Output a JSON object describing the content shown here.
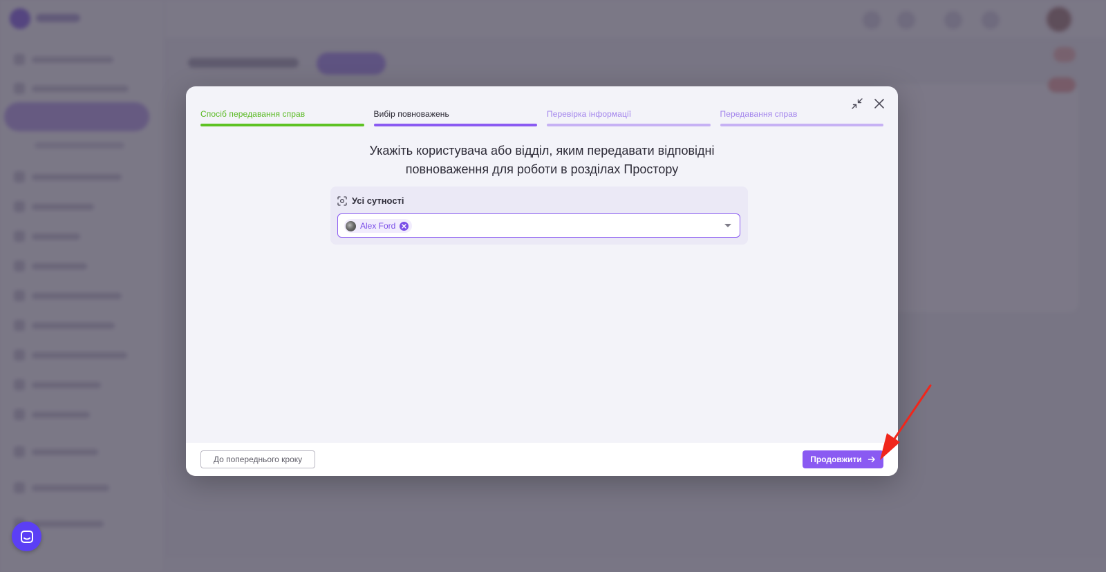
{
  "wizard": {
    "steps": [
      {
        "label": "Спосіб передавання справ",
        "state": "done"
      },
      {
        "label": "Вибір повноважень",
        "state": "active"
      },
      {
        "label": "Перевірка інформації",
        "state": "todo"
      },
      {
        "label": "Передавання справ",
        "state": "todo"
      }
    ],
    "heading_line1": "Укажіть користувача або відділ, яким передавати відповідні",
    "heading_line2": "повноваження для роботи в розділах Простору",
    "entity_title": "Усі сутності",
    "selected_user": "Alex Ford",
    "prev_button": "До попереднього кроку",
    "next_button": "Продовжити"
  },
  "colors": {
    "accent": "#8a5af2",
    "done": "#5ec224",
    "annotation_arrow": "#f0261b"
  },
  "icons": [
    "collapse-icon",
    "close-icon",
    "entity-scan-icon",
    "remove-icon",
    "dropdown-arrow-icon",
    "arrow-right-icon",
    "chat-icon"
  ]
}
